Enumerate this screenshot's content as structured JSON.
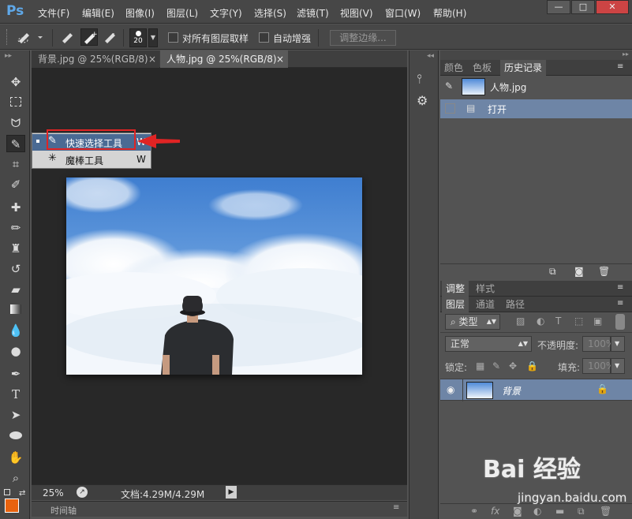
{
  "app": {
    "logo": "Ps"
  },
  "menu": [
    "文件(F)",
    "编辑(E)",
    "图像(I)",
    "图层(L)",
    "文字(Y)",
    "选择(S)",
    "滤镜(T)",
    "视图(V)",
    "窗口(W)",
    "帮助(H)"
  ],
  "window_controls": {
    "minimize": "—",
    "restore": "□",
    "close": "✕"
  },
  "options": {
    "brush_size": "20",
    "sample_all_layers": "对所有图层取样",
    "auto_enhance": "自动增强",
    "refine_edge": "调整边缘..."
  },
  "tabs": [
    {
      "label": "背景.jpg @ 25%(RGB/8)",
      "close": "×"
    },
    {
      "label": "人物.jpg @ 25%(RGB/8)",
      "close": "×"
    }
  ],
  "flyout": {
    "items": [
      {
        "label": "快速选择工具",
        "shortcut": "W",
        "selected": true
      },
      {
        "label": "魔棒工具",
        "shortcut": "W",
        "selected": false
      }
    ]
  },
  "status": {
    "zoom": "25%",
    "doc": "文档:4.29M/4.29M"
  },
  "timeline": {
    "label": "时间轴"
  },
  "panel_color": {
    "tabs": [
      "颜色",
      "色板",
      "历史记录"
    ],
    "history": {
      "snapshot": "人物.jpg",
      "items": [
        "打开"
      ]
    }
  },
  "panel_adjust": {
    "tabs": [
      "调整",
      "样式"
    ]
  },
  "panel_layers": {
    "tabs": [
      "图层",
      "通道",
      "路径"
    ],
    "filter_kind": "类型",
    "blend_mode": "正常",
    "opacity_label": "不透明度:",
    "opacity_value": "100%",
    "lock_label": "锁定:",
    "fill_label": "填充:",
    "fill_value": "100%",
    "layers": [
      {
        "name": "背景"
      }
    ]
  },
  "watermark": {
    "brand": "Bai 经验",
    "url": "jingyan.baidu.com"
  },
  "colors": {
    "foreground": "#e8620e",
    "accent_red": "#e02424",
    "selected": "#4a6a93"
  }
}
